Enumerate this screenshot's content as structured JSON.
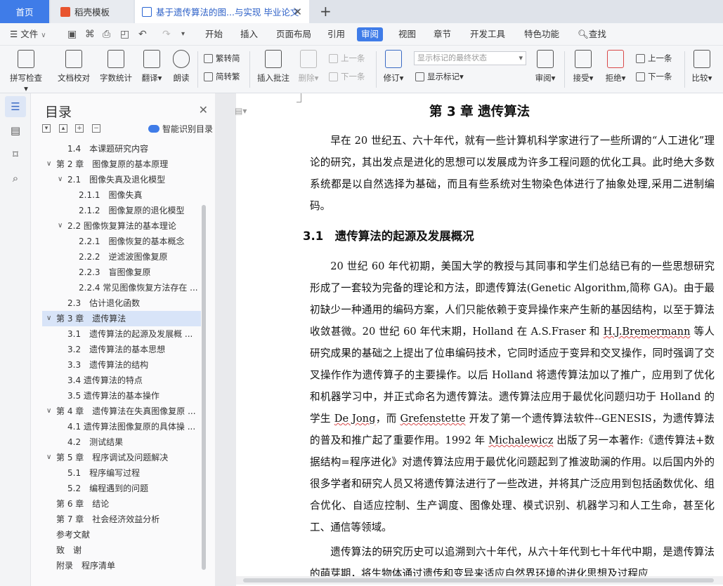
{
  "tabs": {
    "home": "首页",
    "template": "稻壳模板",
    "document": "基于遗传算法的图...与实现 毕业论文",
    "add_icon": "plus-icon"
  },
  "menu": {
    "file": "文件",
    "items": [
      "开始",
      "插入",
      "页面布局",
      "引用",
      "审阅",
      "视图",
      "章节",
      "开发工具",
      "特色功能"
    ],
    "active": "审阅",
    "search": "查找"
  },
  "ribbon": {
    "spell_check": "拼写检查",
    "doc_proof": "文档校对",
    "word_count": "字数统计",
    "translate": "翻译",
    "read_aloud": "朗读",
    "trad_to_simp": "繁转简",
    "simp_to_trad": "简转繁",
    "insert_comment": "插入批注",
    "delete": "删除",
    "prev_comment": "上一条",
    "next_comment": "下一条",
    "track_changes": "修订",
    "markup_state": "显示标记的最终状态",
    "show_markup": "显示标记",
    "review": "审阅",
    "accept": "接受",
    "reject": "拒绝",
    "prev_change": "上一条",
    "next_change": "下一条",
    "compare": "比较"
  },
  "toc": {
    "title": "目录",
    "smart": "智能识别目录",
    "items": [
      {
        "label": "1.4　本课题研究内容",
        "level": 2,
        "chev": ""
      },
      {
        "label": "第 2 章　图像复原的基本原理",
        "level": 1,
        "chev": "v"
      },
      {
        "label": "2.1　图像失真及退化模型",
        "level": 2,
        "chev": "v"
      },
      {
        "label": "2.1.1　图像失真",
        "level": 3,
        "chev": ""
      },
      {
        "label": "2.1.2　图像复原的退化模型",
        "level": 3,
        "chev": ""
      },
      {
        "label": "2.2 图像恢复算法的基本理论",
        "level": 2,
        "chev": "v"
      },
      {
        "label": "2.2.1　图像恢复的基本概念",
        "level": 3,
        "chev": ""
      },
      {
        "label": "2.2.2　逆滤波图像复原",
        "level": 3,
        "chev": ""
      },
      {
        "label": "2.2.3　盲图像复原",
        "level": 3,
        "chev": ""
      },
      {
        "label": "2.2.4 常见图像恢复方法存在 ...",
        "level": 3,
        "chev": ""
      },
      {
        "label": "2.3　估计退化函数",
        "level": 2,
        "chev": ""
      },
      {
        "label": "第 3 章　遗传算法",
        "level": 1,
        "chev": "v",
        "selected": true
      },
      {
        "label": "3.1　遗传算法的起源及发展概 ...",
        "level": 2,
        "chev": ""
      },
      {
        "label": "3.2　遗传算法的基本思想",
        "level": 2,
        "chev": ""
      },
      {
        "label": "3.3　遗传算法的结构",
        "level": 2,
        "chev": ""
      },
      {
        "label": "3.4 遗传算法的特点",
        "level": 2,
        "chev": ""
      },
      {
        "label": "3.5 遗传算法的基本操作",
        "level": 2,
        "chev": ""
      },
      {
        "label": "第 4 章　遗传算法在失真图像复原 ...",
        "level": 1,
        "chev": "v"
      },
      {
        "label": "4.1 遗传算法图像复原的具体操 ...",
        "level": 2,
        "chev": ""
      },
      {
        "label": "4.2　测试结果",
        "level": 2,
        "chev": ""
      },
      {
        "label": "第 5 章　程序调试及问题解决",
        "level": 1,
        "chev": "v"
      },
      {
        "label": "5.1　程序编写过程",
        "level": 2,
        "chev": ""
      },
      {
        "label": "5.2　编程遇到的问题",
        "level": 2,
        "chev": ""
      },
      {
        "label": "第 6 章　结论",
        "level": 1,
        "chev": ""
      },
      {
        "label": "第 7 章　社会经济效益分析",
        "level": 1,
        "chev": ""
      },
      {
        "label": "参考文献",
        "level": 1,
        "chev": ""
      },
      {
        "label": "致　谢",
        "level": 1,
        "chev": ""
      },
      {
        "label": "附录　程序清单",
        "level": 1,
        "chev": ""
      }
    ]
  },
  "doc": {
    "chapter_title": "第 3 章  遗传算法",
    "intro": "早在 20 世纪五、六十年代，就有一些计算机科学家进行了一些所谓的“人工进化”理论的研究，其出发点是进化的思想可以发展成为许多工程问题的优化工具。此时绝大多数系统都是以自然选择为基础，而且有些系统对生物染色体进行了抽象处理,采用二进制编码。",
    "section_title": "3.1　遗传算法的起源及发展概况",
    "p1_a": "20 世纪 60 年代初期，美国大学的教授与其同事和学生们总结已有的一些思想研究形成了一套较为完备的理论和方法，即遗传算法(Genetic Algorithm,简称 GA)。由于最初缺少一种通用的编码方案，人们只能依赖于变异操作来产生新的基因结构，以至于算法收敛甚微。20 世纪 60 年代末期，Holland 在 A.S.Fraser 和 ",
    "p1_w1": "H.J.Bremermann",
    "p1_b": " 等人研究成果的基础之上提出了位串编码技术，它同时适应于变异和交叉操作，同时强调了交叉操作作为遗传算子的主要操作。以后 Holland 将遗传算法加以了推广，应用到了优化和机器学习中，并正式命名为遗传算法。遗传算法应用于最优化问题归功于 Holland 的学生 ",
    "p1_w2": "De Jong",
    "p1_c": "，而 ",
    "p1_w3": "Grefenstette",
    "p1_d": " 开发了第一个遗传算法软件--GENESIS，为遗传算法的普及和推广起了重要作用。1992 年 ",
    "p1_w4": "Michalewicz",
    "p1_e": " 出版了另一本著作:《遗传算法+数据结构=程序进化》对遗传算法应用于最优化问题起到了推波助澜的作用。以后国内外的很多学者和研究人员又将遗传算法进行了一些改进，并将其广泛应用到包括函数优化、组合优化、自适应控制、生产调度、图像处理、模式识别、机器学习和人工生命，甚至化工、通信等领域。",
    "p2": "遗传算法的研究历史可以追溯到六十年代，从六十年代到七十年代中期，是遗传算法的萌芽期，将生物体通过遗传和变异来适应自然界环境的进化思想及过程应"
  }
}
